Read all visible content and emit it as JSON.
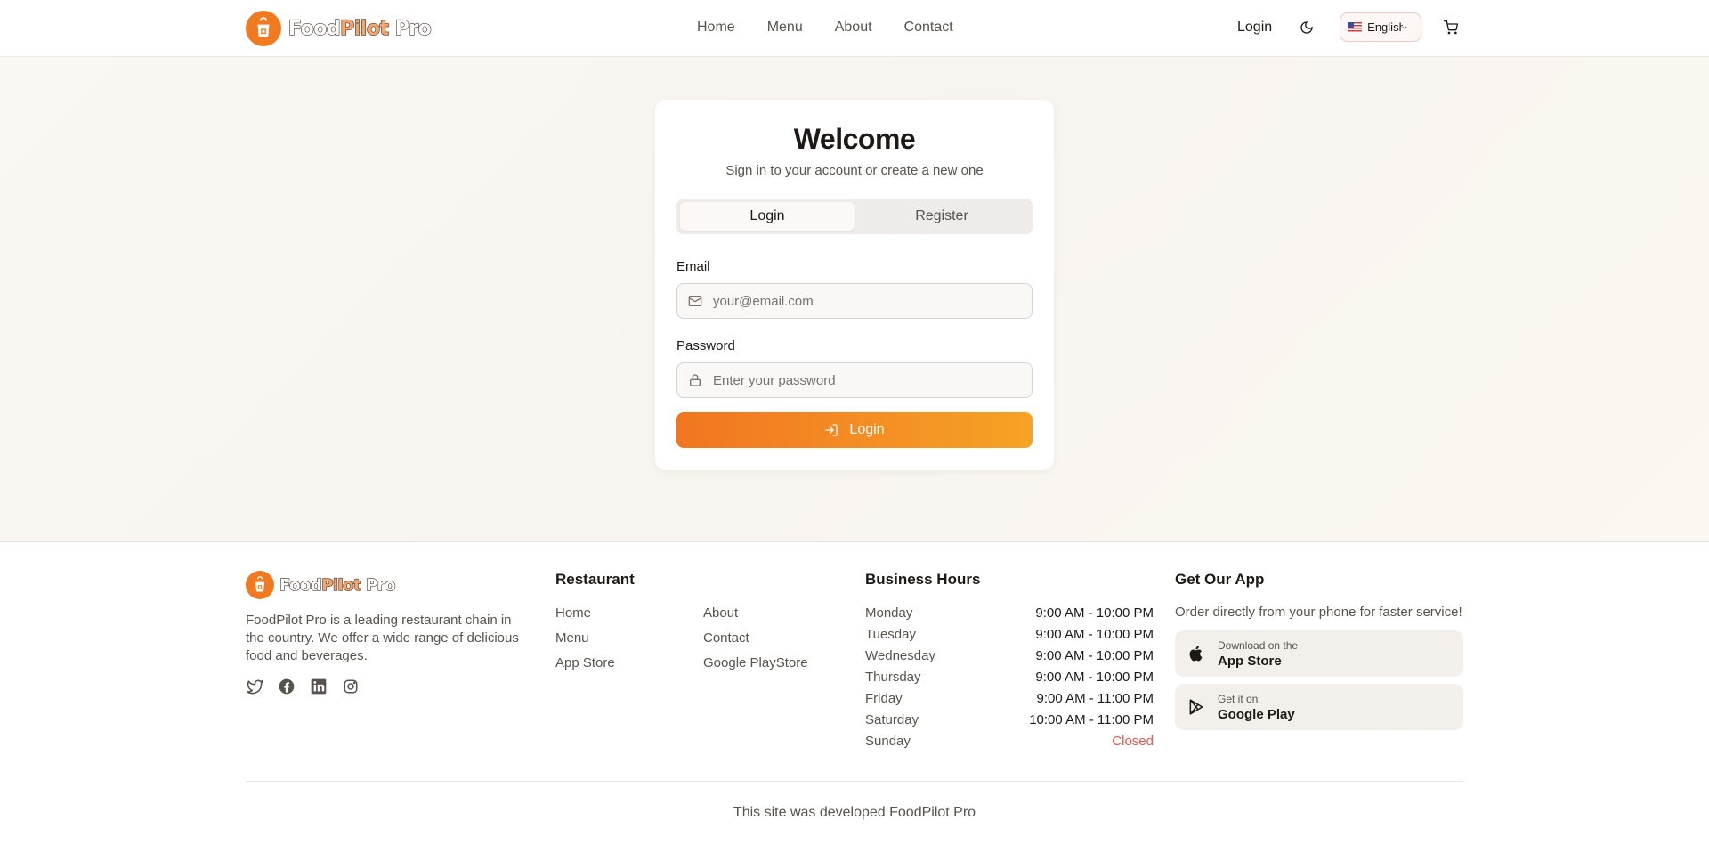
{
  "brand": {
    "name_part1": "Food",
    "name_part2": "Pilot",
    "name_part3": " Pro",
    "accent_color": "#f17a21",
    "logo_icon": "chef-apron-icon"
  },
  "header": {
    "nav": [
      "Home",
      "Menu",
      "About",
      "Contact"
    ],
    "login_label": "Login",
    "theme_icon": "moon-icon",
    "language": {
      "label": "English",
      "flag": "us-flag-icon"
    },
    "cart_icon": "shopping-cart-icon"
  },
  "auth": {
    "title": "Welcome",
    "subtitle": "Sign in to your account or create a new one",
    "tabs": [
      {
        "label": "Login",
        "active": true
      },
      {
        "label": "Register",
        "active": false
      }
    ],
    "email_label": "Email",
    "email_placeholder": "your@email.com",
    "email_value": "",
    "password_label": "Password",
    "password_placeholder": "Enter your password",
    "password_value": "",
    "submit_label": "Login",
    "submit_gradient": [
      "#f27521",
      "#f5a325"
    ]
  },
  "footer": {
    "about": {
      "description": "FoodPilot Pro is a leading restaurant chain in the country. We offer a wide range of delicious food and beverages.",
      "socials": [
        "twitter-icon",
        "facebook-icon",
        "linkedin-icon",
        "instagram-icon"
      ]
    },
    "restaurant": {
      "title": "Restaurant",
      "links": [
        "Home",
        "About",
        "Menu",
        "Contact",
        "App Store",
        "Google PlayStore"
      ]
    },
    "hours": {
      "title": "Business Hours",
      "rows": [
        {
          "day": "Monday",
          "time": "9:00 AM - 10:00 PM"
        },
        {
          "day": "Tuesday",
          "time": "9:00 AM - 10:00 PM"
        },
        {
          "day": "Wednesday",
          "time": "9:00 AM - 10:00 PM"
        },
        {
          "day": "Thursday",
          "time": "9:00 AM - 10:00 PM"
        },
        {
          "day": "Friday",
          "time": "9:00 AM - 11:00 PM"
        },
        {
          "day": "Saturday",
          "time": "10:00 AM - 11:00 PM"
        },
        {
          "day": "Sunday",
          "time": "Closed"
        }
      ],
      "closed_color": "#ef5350"
    },
    "app": {
      "title": "Get Our App",
      "subtitle": "Order directly from your phone for faster service!",
      "app_store": {
        "small": "Download on the",
        "big": "App Store",
        "icon": "apple-icon"
      },
      "google_play": {
        "small": "Get it on",
        "big": "Google Play",
        "icon": "google-play-icon"
      }
    },
    "copyright": "This site was developed FoodPilot Pro"
  }
}
